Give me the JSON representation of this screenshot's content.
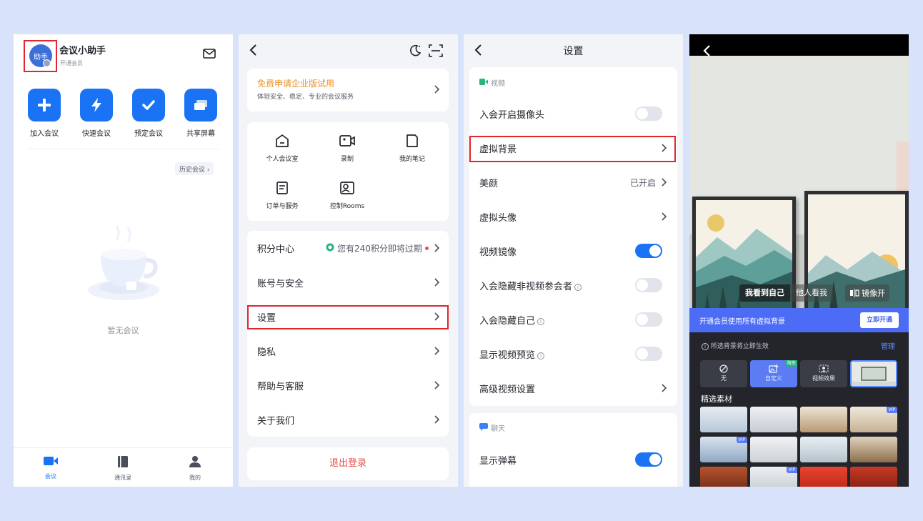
{
  "panel1": {
    "avatar_text": "助手",
    "user_name": "会议小助手",
    "user_sub": "开通会员",
    "quick_actions": [
      {
        "label": "加入会议",
        "icon": "plus-icon"
      },
      {
        "label": "快速会议",
        "icon": "lightning-icon"
      },
      {
        "label": "预定会议",
        "icon": "checkmark-icon"
      },
      {
        "label": "共享屏幕",
        "icon": "share-screen-icon"
      }
    ],
    "history_label": "历史会议 ›",
    "empty_text": "暂无会议",
    "tabs": [
      {
        "label": "会议",
        "icon": "video-camera-icon",
        "active": true
      },
      {
        "label": "通讯录",
        "icon": "contacts-book-icon",
        "active": false
      },
      {
        "label": "我的",
        "icon": "person-icon",
        "active": false
      }
    ]
  },
  "panel2": {
    "trial_title": "免费申请企业版试用",
    "trial_sub": "体验安全、稳定、专业的会议服务",
    "grid": [
      {
        "label": "个人会议室",
        "icon": "house-icon"
      },
      {
        "label": "录制",
        "icon": "record-icon"
      },
      {
        "label": "我的笔记",
        "icon": "note-icon"
      },
      {
        "label": "订单与服务",
        "icon": "order-icon"
      },
      {
        "label": "控制Rooms",
        "icon": "rooms-icon"
      }
    ],
    "menu": [
      {
        "label": "积分中心",
        "value": "您有240积分即将过期"
      },
      {
        "label": "账号与安全",
        "value": ""
      },
      {
        "label": "设置",
        "value": ""
      },
      {
        "label": "隐私",
        "value": ""
      },
      {
        "label": "帮助与客服",
        "value": ""
      },
      {
        "label": "关于我们",
        "value": ""
      }
    ],
    "logout": "退出登录"
  },
  "panel3": {
    "title": "设置",
    "video_section": "视频",
    "rows": [
      {
        "label": "入会开启摄像头",
        "type": "toggle",
        "on": false
      },
      {
        "label": "虚拟背景",
        "type": "chevron"
      },
      {
        "label": "美颜",
        "type": "value",
        "value": "已开启"
      },
      {
        "label": "虚拟头像",
        "type": "chevron"
      },
      {
        "label": "视频镜像",
        "type": "toggle",
        "on": true
      },
      {
        "label": "入会隐藏非视频参会者",
        "type": "toggle",
        "on": false,
        "info": true
      },
      {
        "label": "入会隐藏自己",
        "type": "toggle",
        "on": false,
        "info": true
      },
      {
        "label": "显示视频预览",
        "type": "toggle",
        "on": false,
        "info": true
      },
      {
        "label": "高级视频设置",
        "type": "chevron"
      }
    ],
    "chat_section": "聊天",
    "chat_rows": [
      {
        "label": "显示弹幕",
        "type": "toggle",
        "on": true
      }
    ]
  },
  "panel4": {
    "view_modes": [
      "我看到自己",
      "他人看我",
      "镜像开"
    ],
    "promo_text": "开通会员使用所有虚拟背景",
    "promo_button": "立即开通",
    "tip": "所选背景将立即生效",
    "manage": "管理",
    "options": [
      {
        "label": "无",
        "icon": "no-entry-icon"
      },
      {
        "label": "自定义",
        "icon": "image-add-icon",
        "badge": "限免"
      },
      {
        "label": "视频效果",
        "icon": "person-frame-icon"
      }
    ],
    "featured_label": "精选素材",
    "vip_label": "VIP"
  },
  "colors": {
    "page_bg": "#d9e2fb",
    "accent_blue": "#1a73f5",
    "highlight_red": "#e0262e",
    "trial_orange": "#e8912b"
  }
}
